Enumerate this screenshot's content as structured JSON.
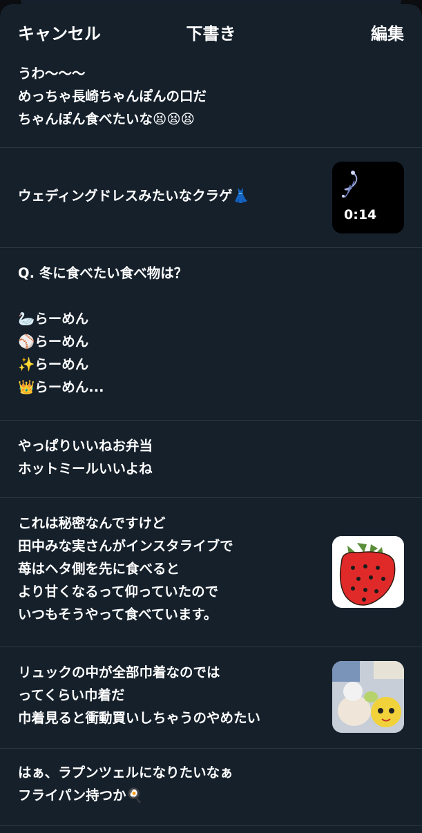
{
  "header": {
    "cancel_label": "キャンセル",
    "title": "下書き",
    "edit_label": "編集"
  },
  "drafts": [
    {
      "text": "うわ〜〜〜\nめっちゃ長崎ちゃんぽんの口だ\nちゃんぽん食べたいな😫😫😫"
    },
    {
      "text": "ウェディングドレスみたいなクラゲ👗",
      "video_duration": "0:14"
    },
    {
      "text": "Q. 冬に食べたい食べ物は？\n\n🦢らーめん\n⚾️らーめん\n✨らーめん\n👑らーめん..."
    },
    {
      "text": "やっぱりいいねお弁当\nホットミールいいよね"
    },
    {
      "text": "これは秘密なんですけど\n田中みな実さんがインスタライブで\n苺はヘタ側を先に食べると\nより甘くなるって仰っていたので\nいつもそうやって食べています。"
    },
    {
      "text": "リュックの中が全部巾着なのでは\nってくらい巾着だ\n巾着見ると衝動買いしちゃうのやめたい"
    },
    {
      "text": "はぁ、ラプンツェルになりたいなぁ\nフライパン持つか🍳"
    }
  ],
  "colors": {
    "background": "#15202b",
    "divider": "#2b3640",
    "text": "#ffffff"
  },
  "icons": [
    "jellyfish-video-thumbnail",
    "strawberry-illustration-thumbnail",
    "pouches-photo-thumbnail"
  ]
}
